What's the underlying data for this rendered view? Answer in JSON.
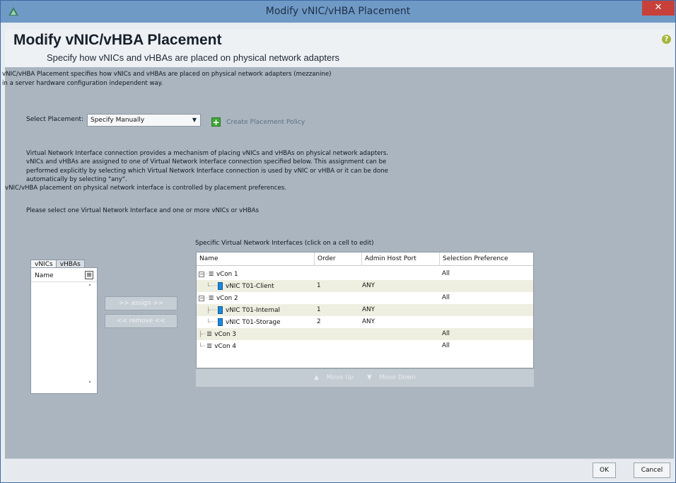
{
  "window": {
    "title": "Modify vNIC/vHBA Placement",
    "close_glyph": "✕"
  },
  "header": {
    "title": "Modify vNIC/vHBA Placement",
    "subtitle": "Specify how vNICs and vHBAs are placed on physical network adapters",
    "help_glyph": "?"
  },
  "intro": {
    "line1": "vNIC/vHBA Placement specifies how vNICs and vHBAs are placed on physical network adapters (mezzanine)",
    "line2": "in a server hardware configuration independent way."
  },
  "placement": {
    "label": "Select Placement:",
    "selected": "Specify Manually",
    "create_policy_label": "Create Placement Policy"
  },
  "description": {
    "lines": [
      "Virtual Network Interface connection provides a mechanism of placing vNICs and vHBAs on physical network adapters.",
      "vNICs and vHBAs are assigned to one of Virtual Network Interface connection specified below. This assignment can be",
      "performed explicitly by selecting which Virtual Network Interface connection is used by vNIC or vHBA or it can be done",
      "automatically by selecting \"any\".",
      "vNIC/vHBA placement on physical network interface is controlled by placement preferences."
    ],
    "please": "Please select one Virtual Network Interface and one or more vNICs or vHBAs"
  },
  "left_panel": {
    "tabs": [
      "vNICs",
      "vHBAs"
    ],
    "active_tab": "vNICs",
    "column_header": "Name"
  },
  "buttons": {
    "assign": ">> assign >>",
    "remove": "<< remove <<",
    "ok": "OK",
    "cancel": "Cancel"
  },
  "interfaces_table": {
    "caption": "Specific Virtual Network Interfaces (click on a cell to edit)",
    "columns": [
      "Name",
      "Order",
      "Admin Host Port",
      "Selection Preference"
    ],
    "rows": [
      {
        "type": "vcon",
        "name": "vCon 1",
        "order": "",
        "port": "",
        "preference": "All"
      },
      {
        "type": "vnic",
        "name": "vNIC T01-Client",
        "order": "1",
        "port": "ANY",
        "preference": ""
      },
      {
        "type": "vcon",
        "name": "vCon 2",
        "order": "",
        "port": "",
        "preference": "All"
      },
      {
        "type": "vnic",
        "name": "vNIC T01-Internal",
        "order": "1",
        "port": "ANY",
        "preference": ""
      },
      {
        "type": "vnic",
        "name": "vNIC T01-Storage",
        "order": "2",
        "port": "ANY",
        "preference": ""
      },
      {
        "type": "vcon",
        "name": "vCon 3",
        "order": "",
        "port": "",
        "preference": "All"
      },
      {
        "type": "vcon",
        "name": "vCon 4",
        "order": "",
        "port": "",
        "preference": "All"
      }
    ],
    "move_up": "Move Up",
    "move_down": "Move Down"
  },
  "colors": {
    "titlebar": "#6f9ac6",
    "panel": "#aab5bf",
    "close": "#c7413a"
  }
}
